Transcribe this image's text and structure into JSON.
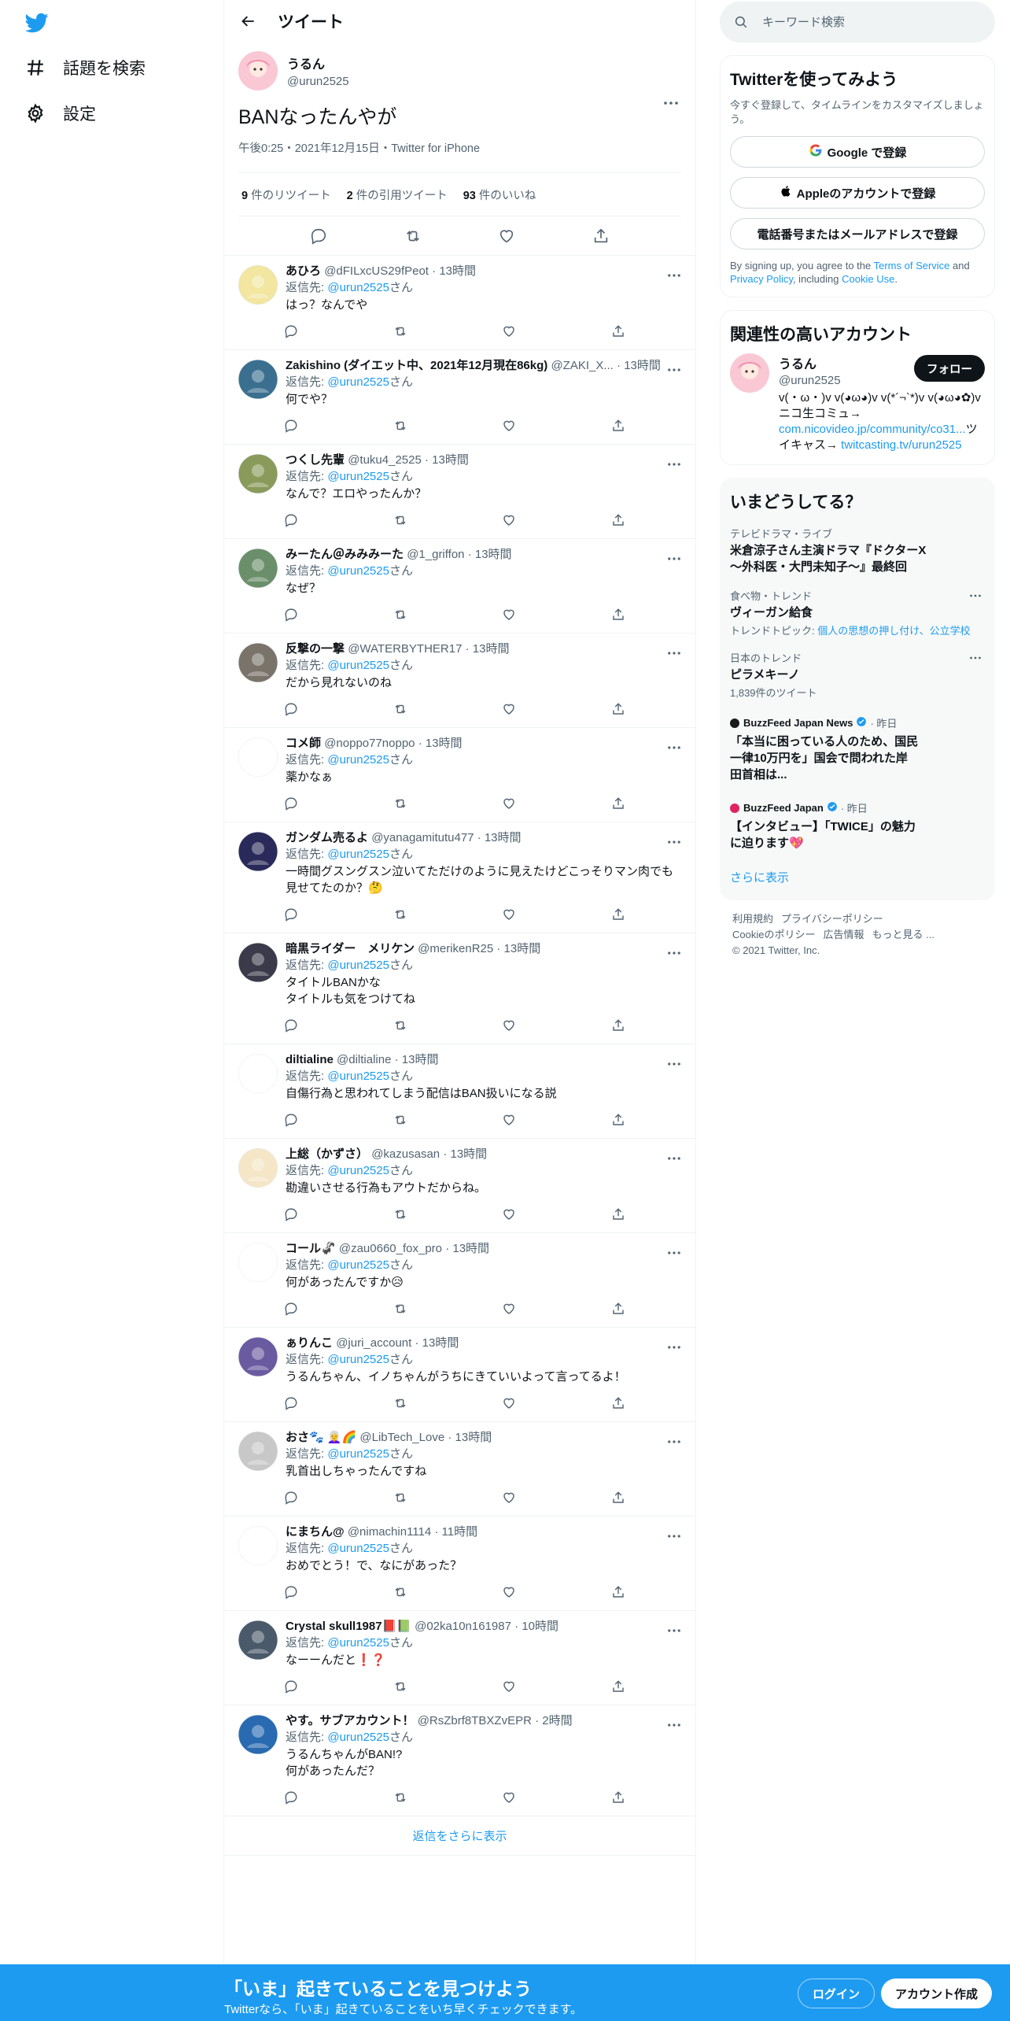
{
  "nav": {
    "explore": "話題を検索",
    "settings": "設定"
  },
  "header": {
    "title": "ツイート"
  },
  "main_tweet": {
    "name": "うるん",
    "handle": "@urun2525",
    "text": "BANなったんやが",
    "meta": "午後0:25・2021年12月15日・Twitter for iPhone",
    "retweets": "9",
    "retweets_label": "件のリツイート",
    "quotes": "2",
    "quotes_label": "件の引用ツイート",
    "likes": "93",
    "likes_label": "件のいいね"
  },
  "reply_prefix": "返信先: ",
  "reply_to": "@urun2525",
  "reply_suffix": "さん",
  "replies": [
    {
      "name": "あひろ",
      "handle": "@dFILxcUS29fPeot",
      "time": "· 13時間",
      "text": "はっ？なんでや",
      "avatar_color": "#f2e6a0"
    },
    {
      "name": "Zakishino (ダイエット中、2021年12月現在86kg)",
      "handle": "@ZAKI_X...",
      "time": "· 13時間",
      "text": "何でや？",
      "avatar_color": "#3b6f8f"
    },
    {
      "name": "つくし先輩",
      "handle": "@tuku4_2525",
      "time": "· 13時間",
      "text": "なんで？エロやったんか？",
      "avatar_color": "#8a9a5b"
    },
    {
      "name": "みーたん＠みみみーた",
      "handle": "@1_griffon",
      "time": "· 13時間",
      "text": "なぜ？",
      "avatar_color": "#6a8f6a"
    },
    {
      "name": "反撃の一撃",
      "handle": "@WATERBYTHER17",
      "time": "· 13時間",
      "text": "だから見れないのね",
      "avatar_color": "#7a736a"
    },
    {
      "name": "コメ師",
      "handle": "@noppo77noppo",
      "time": "· 13時間",
      "text": "薬かなぁ",
      "avatar_color": "#ffffff"
    },
    {
      "name": "ガンダム売るよ",
      "handle": "@yanagamitutu477",
      "time": "· 13時間",
      "text": "一時間グスングスン泣いてただけのように見えたけどこっそりマン肉でも見せてたのか？🤔",
      "avatar_color": "#2a2a5a"
    },
    {
      "name": "暗黒ライダー　メリケン",
      "handle": "@merikenR25",
      "time": "· 13時間",
      "text": "タイトルBANかな\nタイトルも気をつけてね",
      "avatar_color": "#3a3a4a"
    },
    {
      "name": "diltialine",
      "handle": "@diltialine",
      "time": "· 13時間",
      "text": "自傷行為と思われてしまう配信はBAN扱いになる説",
      "avatar_color": "#ffffff"
    },
    {
      "name": "上総（かずさ）",
      "handle": "@kazusasan",
      "time": "· 13時間",
      "text": "勘違いさせる行為もアウトだからね。",
      "avatar_color": "#f5e6c8"
    },
    {
      "name": "コール🦨",
      "handle": "@zau0660_fox_pro",
      "time": "· 13時間",
      "text": "何があったんですか😥",
      "avatar_color": "#ffffff"
    },
    {
      "name": "ぁりんこ",
      "handle": "@juri_account",
      "time": "· 13時間",
      "text": "うるんちゃん、イノちゃんがうちにきていいよって言ってるよ！",
      "avatar_color": "#6a5aa0"
    },
    {
      "name": "おさ🐾 👩‍🦳🌈",
      "handle": "@LibTech_Love",
      "time": "· 13時間",
      "text": "乳首出しちゃったんですね",
      "avatar_color": "#c8c8c8"
    },
    {
      "name": "にまちん@",
      "handle": "@nimachin1114",
      "time": "· 11時間",
      "text": "おめでとう！で、なにがあった？",
      "avatar_color": "#ffffff"
    },
    {
      "name": "Crystal skull1987📕📗",
      "handle": "@02ka10n161987",
      "time": "· 10時間",
      "text": "なーーんだと❗❓",
      "avatar_color": "#4a5a6a"
    },
    {
      "name": "やす。サブアカウント！",
      "handle": "@RsZbrf8TBXZvEPR",
      "time": "· 2時間",
      "text": "うるんちゃんがBAN!?\n何があったんだ？",
      "avatar_color": "#2a6ab0"
    }
  ],
  "show_more_replies": "返信をさらに表示",
  "search": {
    "placeholder": "キーワード検索"
  },
  "signup_card": {
    "title": "Twitterを使ってみよう",
    "subtitle": "今すぐ登録して、タイムラインをカスタマイズしましょう。",
    "google": "Google で登録",
    "apple": "Appleのアカウントで登録",
    "phone": "電話番号またはメールアドレスで登録",
    "legal_1": "By signing up, you agree to the ",
    "tos": "Terms of Service",
    "legal_2": " and ",
    "privacy": "Privacy Policy",
    "legal_3": ", including ",
    "cookie": "Cookie Use",
    "legal_4": "."
  },
  "related": {
    "title": "関連性の高いアカウント",
    "name": "うるん",
    "handle": "@urun2525",
    "follow": "フォロー",
    "bio_1": "v(・ω・)v v(◕ω◕)v v(*´¬`*)v v(◕ω◕✿)vニコ生コミュ→",
    "bio_link1": "com.nicovideo.jp/community/co31...",
    "bio_2": "ツイキャス→ ",
    "bio_link2": "twitcasting.tv/urun2525"
  },
  "trends": {
    "title": "いまどうしてる？",
    "items": [
      {
        "context": "テレビドラマ・ライブ",
        "title": "米倉涼子さん主演ドラマ『ドクターX～外科医・大門未知子～』最終回",
        "extra": ""
      },
      {
        "context": "食べ物・トレンド",
        "title": "ヴィーガン給食",
        "extra_prefix": "トレンドトピック: ",
        "extra_link": "個人の思想の押し付け、公立学校"
      },
      {
        "context": "日本のトレンド",
        "title": "ピラメキーノ",
        "extra": "1,839件のツイート"
      }
    ],
    "news": [
      {
        "source": "BuzzFeed Japan News",
        "time": "· 昨日",
        "title": "「本当に困っている人のため、国民一律10万円を」国会で問われた岸田首相は...",
        "color": "#1a1a1a"
      },
      {
        "source": "BuzzFeed Japan",
        "time": "· 昨日",
        "title": "【インタビュー】「TWICE」の魅力に迫ります💖",
        "color": "#e0245e"
      }
    ],
    "show_more": "さらに表示"
  },
  "footer": {
    "links": [
      "利用規約",
      "プライバシーポリシー",
      "Cookieのポリシー",
      "広告情報",
      "もっと見る ..."
    ],
    "copyright": "© 2021 Twitter, Inc."
  },
  "bottom": {
    "headline": "「いま」起きていることを見つけよう",
    "sub": "Twitterなら、「いま」起きていることをいち早くチェックできます。",
    "login": "ログイン",
    "signup": "アカウント作成"
  },
  "colors": {
    "accent": "#1d9bf0",
    "text": "#0f1419",
    "muted": "#536471"
  }
}
